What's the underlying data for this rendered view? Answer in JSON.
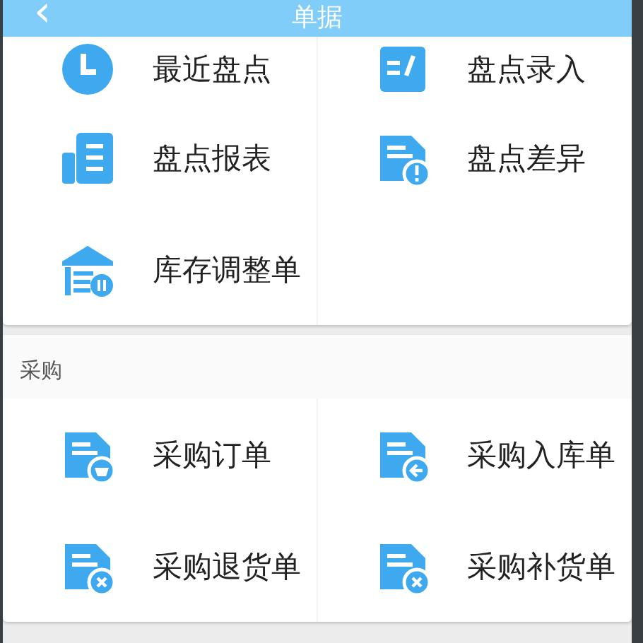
{
  "header": {
    "back": "‹",
    "title": "单据"
  },
  "sections": [
    {
      "items": [
        "最近盘点",
        "盘点录入",
        "盘点报表",
        "盘点差异",
        "库存调整单"
      ]
    },
    {
      "title": "采购",
      "items": [
        "采购订单",
        "采购入库单",
        "采购退货单",
        "采购补货单"
      ]
    }
  ]
}
